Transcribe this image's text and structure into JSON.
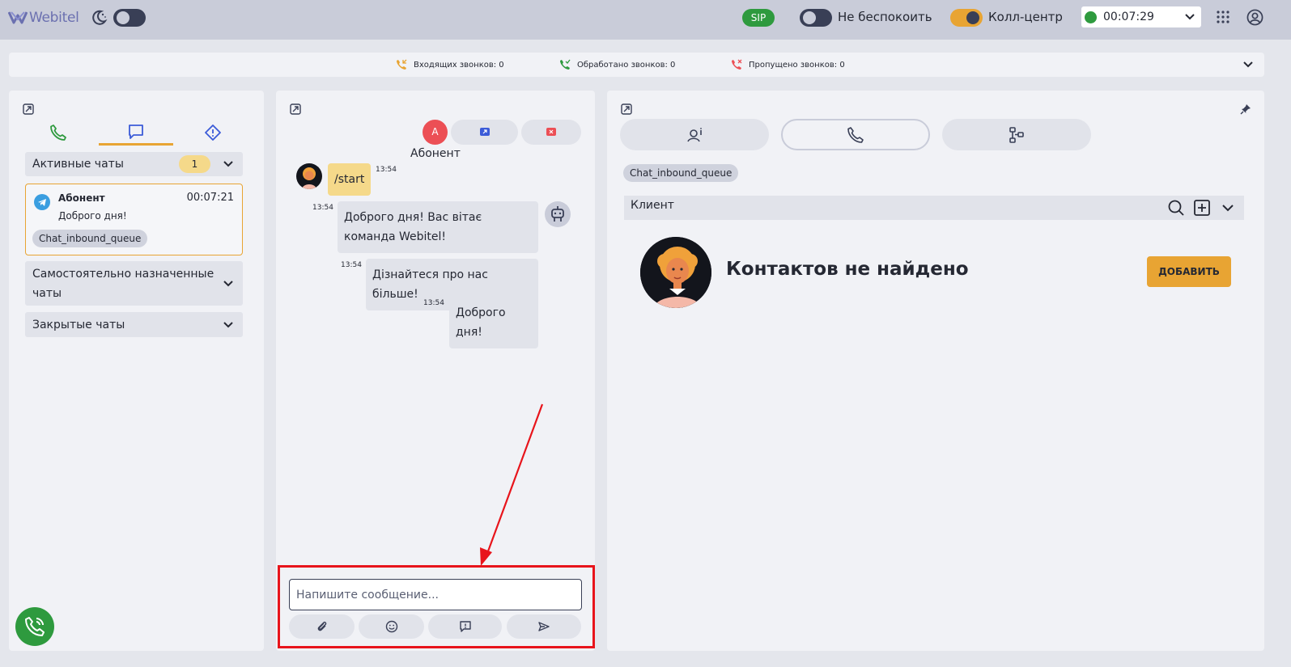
{
  "header": {
    "logo_text": "Webitel",
    "sip_label": "SIP",
    "dnd_label": "Не беспокоить",
    "callcenter_label": "Колл-центр",
    "status_time": "00:07:29"
  },
  "stats": {
    "incoming": "Входящих звонков: 0",
    "handled": "Обработано звонков: 0",
    "missed": "Пропущено звонков: 0"
  },
  "left_panel": {
    "active_title": "Активные чаты",
    "active_count": "1",
    "card": {
      "name": "Абонент",
      "time": "00:07:21",
      "message": "Доброго дня!",
      "queue": "Chat_inbound_queue"
    },
    "self_assigned_title": "Самостоятельно назначенные чаты",
    "closed_title": "Закрытые чаты"
  },
  "chat": {
    "avatar_letter": "A",
    "title": "Абонент",
    "messages": [
      {
        "text": "/start",
        "time": "13:54"
      },
      {
        "text": "Доброго дня! Вас вітає команда Webitel!",
        "time": "13:54"
      },
      {
        "text": "Дізнайтеся про нас більше!",
        "time": "13:54"
      },
      {
        "text": "Доброго дня!",
        "time": "13:54"
      }
    ],
    "input_placeholder": "Напишите сообщение..."
  },
  "right_panel": {
    "queue_chip": "Chat_inbound_queue",
    "client_title": "Клиент",
    "no_contacts": "Контактов не найдено",
    "add_button": "ДОБАВИТЬ"
  },
  "colors": {
    "accent": "#e8a433",
    "success": "#2e9a3e",
    "danger": "#ec4f55",
    "highlight": "#e8141b",
    "dark": "#393f56"
  }
}
